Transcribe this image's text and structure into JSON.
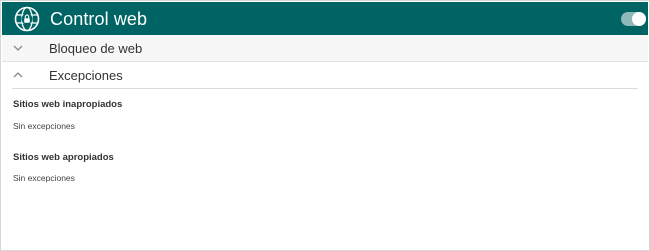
{
  "header": {
    "title": "Control web",
    "icon": "web-globe-lock-icon",
    "background_color": "#006464",
    "toggle_state": "on"
  },
  "rows": [
    {
      "label": "Bloqueo de web",
      "icon": "chevron-down-icon",
      "expanded": false
    },
    {
      "label": "Excepciones",
      "icon": "chevron-up-icon",
      "expanded": true
    }
  ],
  "exceptions": {
    "inappropriate": {
      "title": "Sitios web inapropiados",
      "value": "Sin excepciones"
    },
    "appropriate": {
      "title": "Sitios web apropiados",
      "value": "Sin excepciones"
    }
  }
}
